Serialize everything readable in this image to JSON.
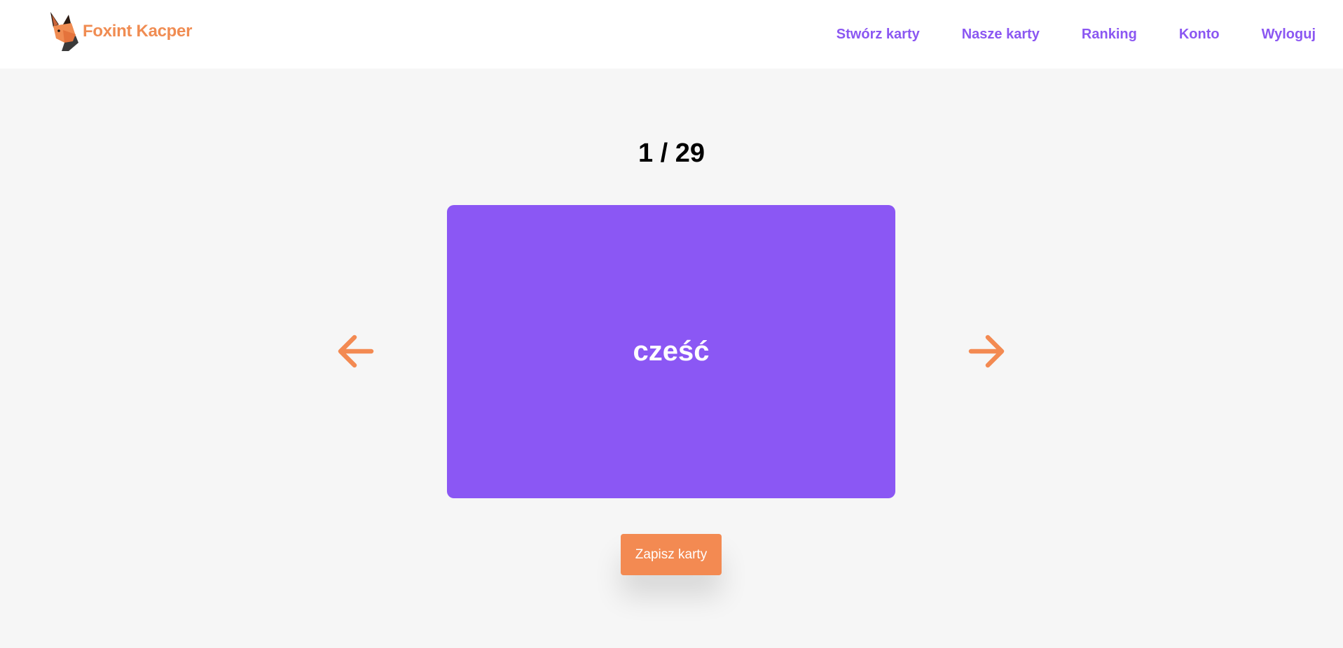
{
  "header": {
    "brand": "Foxint Kacper",
    "nav": [
      {
        "label": "Stwórz karty"
      },
      {
        "label": "Nasze karty"
      },
      {
        "label": "Ranking"
      },
      {
        "label": "Konto"
      },
      {
        "label": "Wyloguj"
      }
    ]
  },
  "flashcards": {
    "counter": "1 / 29",
    "current_word": "cześć",
    "save_label": "Zapisz karty"
  },
  "colors": {
    "accent_purple": "#8b57f4",
    "accent_orange": "#f38a52",
    "background": "#f6f6f6"
  },
  "icons": {
    "logo": "fox-head-icon",
    "prev": "arrow-left-icon",
    "next": "arrow-right-icon"
  }
}
